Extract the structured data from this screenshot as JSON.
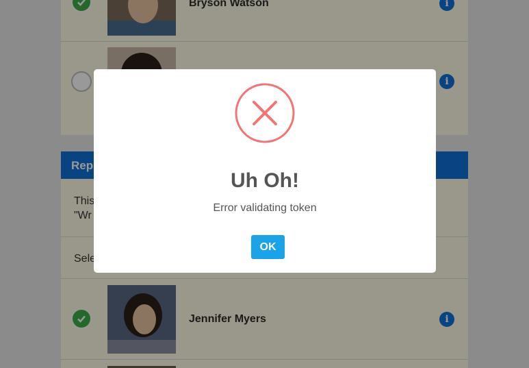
{
  "students_top": [
    {
      "name": "Bryson Watson",
      "selected": true
    },
    {
      "name": "",
      "selected": false
    }
  ],
  "report_section": {
    "header": "Rep",
    "description_line1": "This",
    "description_line2": "\"Wr",
    "select_label": "Sele"
  },
  "students_bottom": [
    {
      "name": "Jennifer Myers",
      "selected": true
    }
  ],
  "info_glyph": "i",
  "modal": {
    "title": "Uh Oh!",
    "message": "Error validating token",
    "ok_label": "OK",
    "icon": "error-x-icon",
    "icon_color": "#f27474"
  },
  "colors": {
    "accent": "#1170d8",
    "ok_button": "#1aa3e8",
    "check_green": "#3fae49",
    "card_background": "#fffde6"
  }
}
